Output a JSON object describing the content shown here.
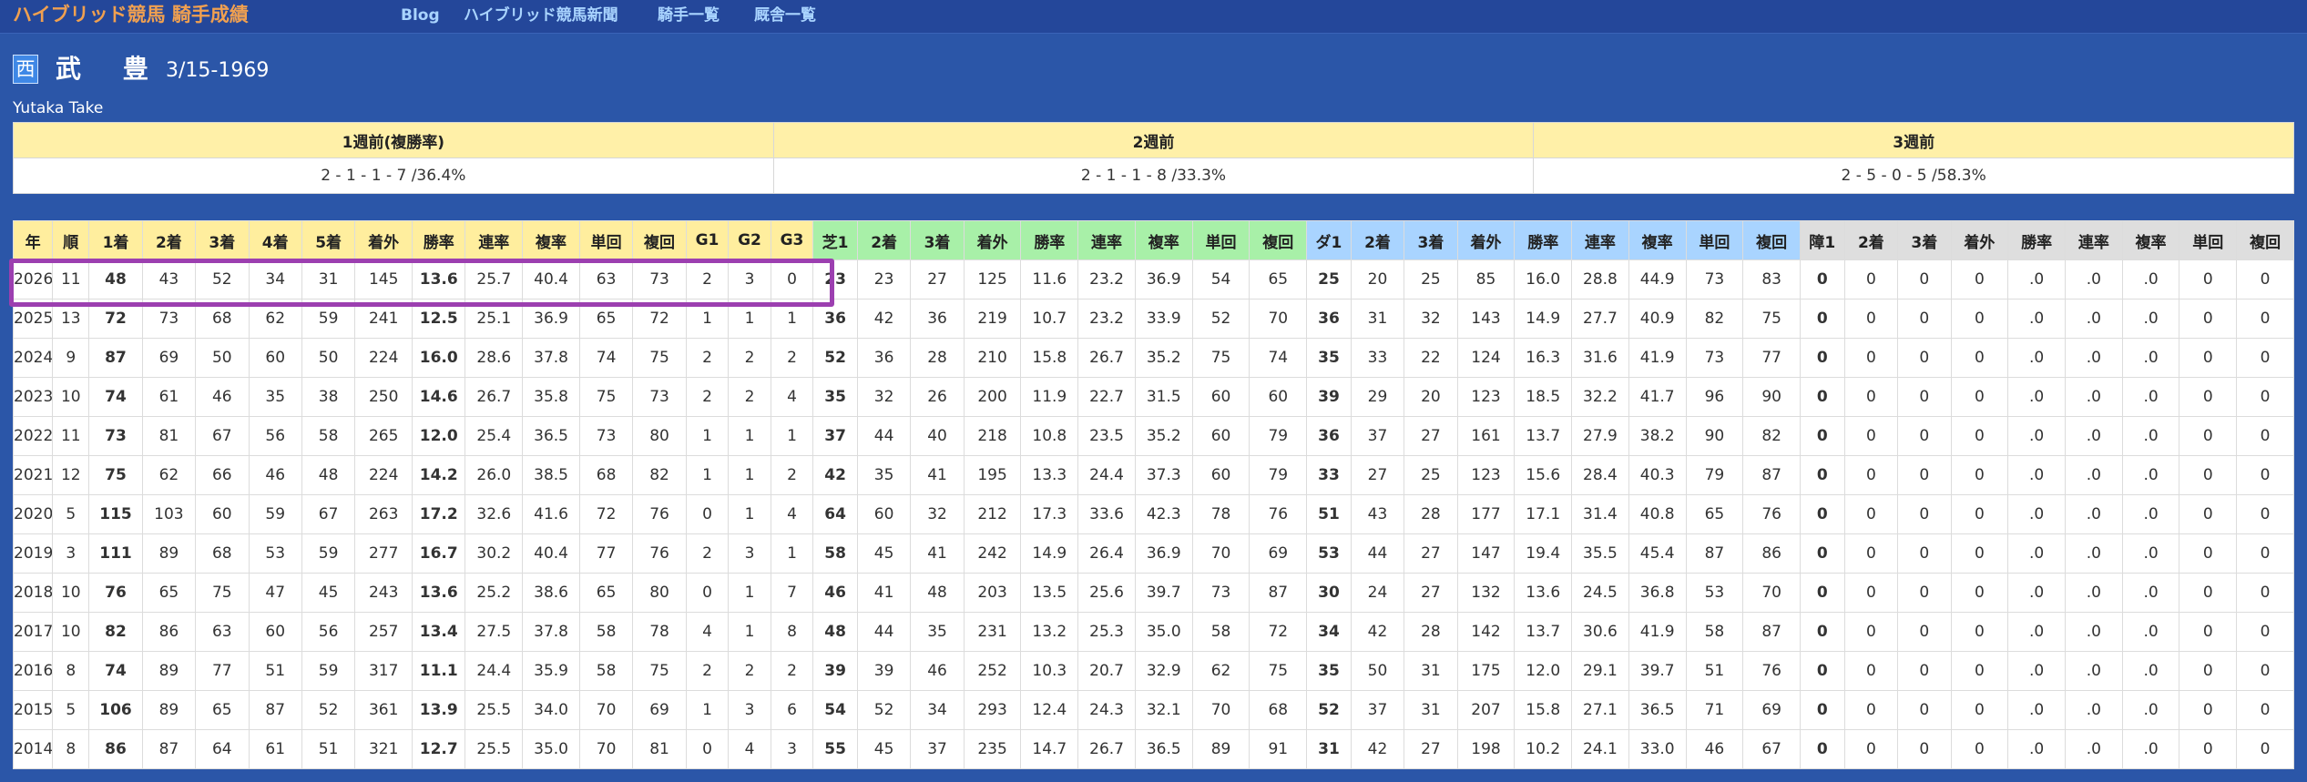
{
  "app": {
    "title": "ハイブリッド競馬 騎手成績"
  },
  "nav": {
    "items": [
      "Blog",
      "ハイブリッド競馬新聞",
      "騎手一覧",
      "厩舎一覧"
    ]
  },
  "jockey": {
    "affiliation": "西",
    "name": "武 豊",
    "birth": "3/15-1969",
    "romaji": "Yutaka Take"
  },
  "weekly": {
    "headers": [
      "1週前(複勝率)",
      "2週前",
      "3週前"
    ],
    "values": [
      "2 - 1 - 1 - 7 /36.4%",
      "2 - 1 - 1 - 8 /33.3%",
      "2 - 5 - 0 - 5 /58.3%"
    ]
  },
  "stats": {
    "headers": [
      "年",
      "順",
      "1着",
      "2着",
      "3着",
      "4着",
      "5着",
      "着外",
      "勝率",
      "連率",
      "複率",
      "単回",
      "複回",
      "G1",
      "G2",
      "G3",
      "芝1",
      "2着",
      "3着",
      "着外",
      "勝率",
      "連率",
      "複率",
      "単回",
      "複回",
      "ダ1",
      "2着",
      "3着",
      "着外",
      "勝率",
      "連率",
      "複率",
      "単回",
      "複回",
      "障1",
      "2着",
      "3着",
      "着外",
      "勝率",
      "連率",
      "複率",
      "単回",
      "複回"
    ],
    "rows": [
      [
        "2026",
        "11",
        "48",
        "43",
        "52",
        "34",
        "31",
        "145",
        "13.6",
        "25.7",
        "40.4",
        "63",
        "73",
        "2",
        "3",
        "0",
        "23",
        "23",
        "27",
        "125",
        "11.6",
        "23.2",
        "36.9",
        "54",
        "65",
        "25",
        "20",
        "25",
        "85",
        "16.0",
        "28.8",
        "44.9",
        "73",
        "83",
        "0",
        "0",
        "0",
        "0",
        ".0",
        ".0",
        ".0",
        "0",
        "0"
      ],
      [
        "2025",
        "13",
        "72",
        "73",
        "68",
        "62",
        "59",
        "241",
        "12.5",
        "25.1",
        "36.9",
        "65",
        "72",
        "1",
        "1",
        "1",
        "36",
        "42",
        "36",
        "219",
        "10.7",
        "23.2",
        "33.9",
        "52",
        "70",
        "36",
        "31",
        "32",
        "143",
        "14.9",
        "27.7",
        "40.9",
        "82",
        "75",
        "0",
        "0",
        "0",
        "0",
        ".0",
        ".0",
        ".0",
        "0",
        "0"
      ],
      [
        "2024",
        "9",
        "87",
        "69",
        "50",
        "60",
        "50",
        "224",
        "16.0",
        "28.6",
        "37.8",
        "74",
        "75",
        "2",
        "2",
        "2",
        "52",
        "36",
        "28",
        "210",
        "15.8",
        "26.7",
        "35.2",
        "75",
        "74",
        "35",
        "33",
        "22",
        "124",
        "16.3",
        "31.6",
        "41.9",
        "73",
        "77",
        "0",
        "0",
        "0",
        "0",
        ".0",
        ".0",
        ".0",
        "0",
        "0"
      ],
      [
        "2023",
        "10",
        "74",
        "61",
        "46",
        "35",
        "38",
        "250",
        "14.6",
        "26.7",
        "35.8",
        "75",
        "73",
        "2",
        "2",
        "4",
        "35",
        "32",
        "26",
        "200",
        "11.9",
        "22.7",
        "31.5",
        "60",
        "60",
        "39",
        "29",
        "20",
        "123",
        "18.5",
        "32.2",
        "41.7",
        "96",
        "90",
        "0",
        "0",
        "0",
        "0",
        ".0",
        ".0",
        ".0",
        "0",
        "0"
      ],
      [
        "2022",
        "11",
        "73",
        "81",
        "67",
        "56",
        "58",
        "265",
        "12.0",
        "25.4",
        "36.5",
        "73",
        "80",
        "1",
        "1",
        "1",
        "37",
        "44",
        "40",
        "218",
        "10.8",
        "23.5",
        "35.2",
        "60",
        "79",
        "36",
        "37",
        "27",
        "161",
        "13.7",
        "27.9",
        "38.2",
        "90",
        "82",
        "0",
        "0",
        "0",
        "0",
        ".0",
        ".0",
        ".0",
        "0",
        "0"
      ],
      [
        "2021",
        "12",
        "75",
        "62",
        "66",
        "46",
        "48",
        "224",
        "14.2",
        "26.0",
        "38.5",
        "68",
        "82",
        "1",
        "1",
        "2",
        "42",
        "35",
        "41",
        "195",
        "13.3",
        "24.4",
        "37.3",
        "60",
        "79",
        "33",
        "27",
        "25",
        "123",
        "15.6",
        "28.4",
        "40.3",
        "79",
        "87",
        "0",
        "0",
        "0",
        "0",
        ".0",
        ".0",
        ".0",
        "0",
        "0"
      ],
      [
        "2020",
        "5",
        "115",
        "103",
        "60",
        "59",
        "67",
        "263",
        "17.2",
        "32.6",
        "41.6",
        "72",
        "76",
        "0",
        "1",
        "4",
        "64",
        "60",
        "32",
        "212",
        "17.3",
        "33.6",
        "42.3",
        "78",
        "76",
        "51",
        "43",
        "28",
        "177",
        "17.1",
        "31.4",
        "40.8",
        "65",
        "76",
        "0",
        "0",
        "0",
        "0",
        ".0",
        ".0",
        ".0",
        "0",
        "0"
      ],
      [
        "2019",
        "3",
        "111",
        "89",
        "68",
        "53",
        "59",
        "277",
        "16.7",
        "30.2",
        "40.4",
        "77",
        "76",
        "2",
        "3",
        "1",
        "58",
        "45",
        "41",
        "242",
        "14.9",
        "26.4",
        "36.9",
        "70",
        "69",
        "53",
        "44",
        "27",
        "147",
        "19.4",
        "35.5",
        "45.4",
        "87",
        "86",
        "0",
        "0",
        "0",
        "0",
        ".0",
        ".0",
        ".0",
        "0",
        "0"
      ],
      [
        "2018",
        "10",
        "76",
        "65",
        "75",
        "47",
        "45",
        "243",
        "13.6",
        "25.2",
        "38.6",
        "65",
        "80",
        "0",
        "1",
        "7",
        "46",
        "41",
        "48",
        "203",
        "13.5",
        "25.6",
        "39.7",
        "73",
        "87",
        "30",
        "24",
        "27",
        "132",
        "13.6",
        "24.5",
        "36.8",
        "53",
        "70",
        "0",
        "0",
        "0",
        "0",
        ".0",
        ".0",
        ".0",
        "0",
        "0"
      ],
      [
        "2017",
        "10",
        "82",
        "86",
        "63",
        "60",
        "56",
        "257",
        "13.4",
        "27.5",
        "37.8",
        "58",
        "78",
        "4",
        "1",
        "8",
        "48",
        "44",
        "35",
        "231",
        "13.2",
        "25.3",
        "35.0",
        "58",
        "72",
        "34",
        "42",
        "28",
        "142",
        "13.7",
        "30.6",
        "41.9",
        "58",
        "87",
        "0",
        "0",
        "0",
        "0",
        ".0",
        ".0",
        ".0",
        "0",
        "0"
      ],
      [
        "2016",
        "8",
        "74",
        "89",
        "77",
        "51",
        "59",
        "317",
        "11.1",
        "24.4",
        "35.9",
        "58",
        "75",
        "2",
        "2",
        "2",
        "39",
        "39",
        "46",
        "252",
        "10.3",
        "20.7",
        "32.9",
        "62",
        "75",
        "35",
        "50",
        "31",
        "175",
        "12.0",
        "29.1",
        "39.7",
        "51",
        "76",
        "0",
        "0",
        "0",
        "0",
        ".0",
        ".0",
        ".0",
        "0",
        "0"
      ],
      [
        "2015",
        "5",
        "106",
        "89",
        "65",
        "87",
        "52",
        "361",
        "13.9",
        "25.5",
        "34.0",
        "70",
        "69",
        "1",
        "3",
        "6",
        "54",
        "52",
        "34",
        "293",
        "12.4",
        "24.3",
        "32.1",
        "70",
        "68",
        "52",
        "37",
        "31",
        "207",
        "15.8",
        "27.1",
        "36.5",
        "71",
        "69",
        "0",
        "0",
        "0",
        "0",
        ".0",
        ".0",
        ".0",
        "0",
        "0"
      ],
      [
        "2014",
        "8",
        "86",
        "87",
        "64",
        "61",
        "51",
        "321",
        "12.7",
        "25.5",
        "35.0",
        "70",
        "81",
        "0",
        "4",
        "3",
        "55",
        "45",
        "37",
        "235",
        "14.7",
        "26.7",
        "36.5",
        "89",
        "91",
        "31",
        "42",
        "27",
        "198",
        "10.2",
        "24.1",
        "33.0",
        "46",
        "67",
        "0",
        "0",
        "0",
        "0",
        ".0",
        ".0",
        ".0",
        "0",
        "0"
      ]
    ]
  },
  "colors": {
    "page_bg": "#2b56a8",
    "brand": "#f0a050",
    "nav_link": "#a9d4ff",
    "header_overall": "#ffee9e",
    "header_turf": "#a8f0a8",
    "header_dirt": "#a9d4ff",
    "header_jump": "#dedede",
    "highlight_border": "#9c3fb0"
  }
}
